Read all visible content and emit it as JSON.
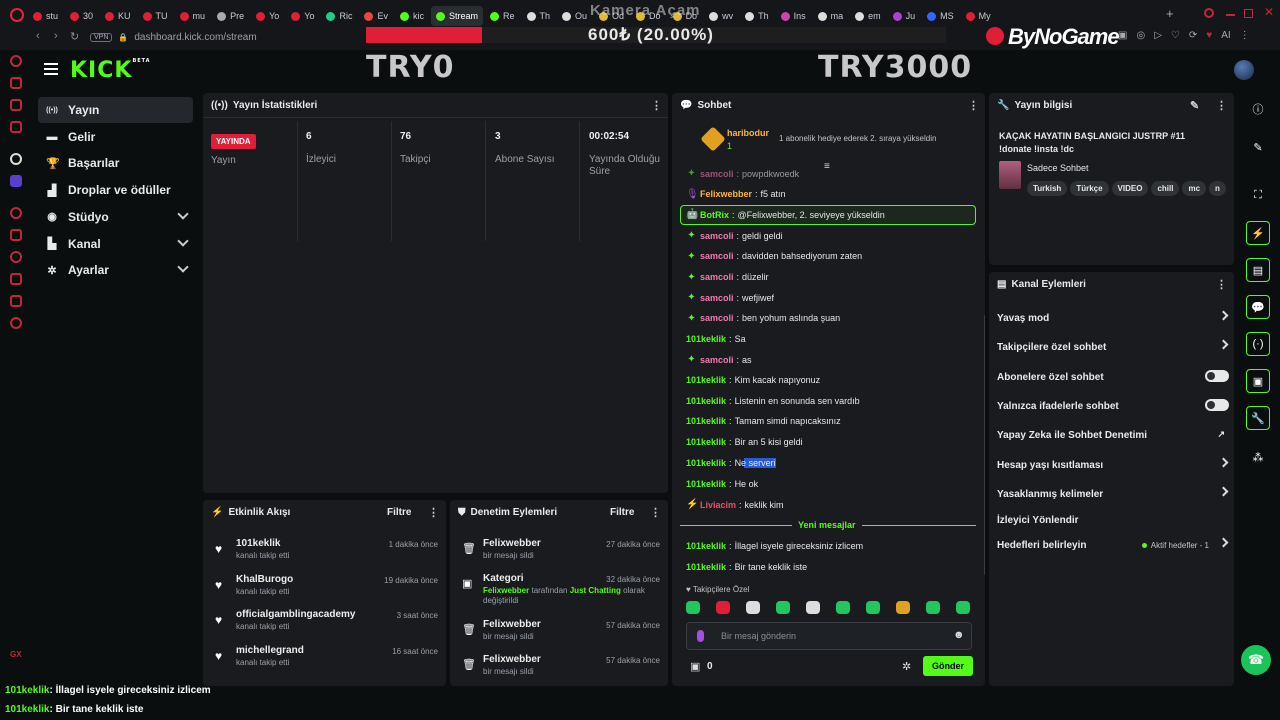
{
  "browser": {
    "tabs": [
      "stu",
      "30",
      "KU",
      "TU",
      "mu",
      "Pre",
      "Yo",
      "Yo",
      "Ric",
      "Ev",
      "kic",
      "Stream",
      "Re",
      "Th",
      "Ou",
      "Od",
      "Do",
      "Do",
      "wv",
      "Th",
      "Ins",
      "ma",
      "em",
      "Ju",
      "MS",
      "My"
    ],
    "active_tab_index": 11,
    "vpn": "VPN",
    "url": "dashboard.kick.com/stream"
  },
  "overlay": {
    "donation_title": "Kamera Açam",
    "donation_amount": "600₺ (20.00%)",
    "donation_progress": 0.2,
    "goal_left": "TRY0",
    "goal_right": "TRY3000",
    "sponsor": "ByNoGame",
    "ai_label": "AI"
  },
  "kick": {
    "logo": "KICK",
    "beta": "BETA"
  },
  "nav": [
    {
      "label": "Yayın",
      "icon": "broadcast-icon",
      "glyph": "((•))",
      "active": true,
      "expand": false
    },
    {
      "label": "Gelir",
      "icon": "revenue-icon",
      "glyph": "▬",
      "active": false,
      "expand": false
    },
    {
      "label": "Başarılar",
      "icon": "trophy-icon",
      "glyph": "🏆",
      "active": false,
      "expand": false
    },
    {
      "label": "Droplar ve ödüller",
      "icon": "drops-icon",
      "glyph": "▟",
      "active": false,
      "expand": false
    },
    {
      "label": "Stüdyo",
      "icon": "studio-icon",
      "glyph": "◉",
      "active": false,
      "expand": true
    },
    {
      "label": "Kanal",
      "icon": "channel-icon",
      "glyph": "▙",
      "active": false,
      "expand": true
    },
    {
      "label": "Ayarlar",
      "icon": "settings-icon",
      "glyph": "✲",
      "active": false,
      "expand": true
    }
  ],
  "stats": {
    "title": "Yayın İstatistikleri",
    "live_badge": "YAYINDA",
    "items": [
      {
        "value": "",
        "label": "Yayın"
      },
      {
        "value": "6",
        "label": "İzleyici"
      },
      {
        "value": "76",
        "label": "Takipçi"
      },
      {
        "value": "3",
        "label": "Abone Sayısı"
      },
      {
        "value": "00:02:54",
        "label": "Yayında Olduğu Süre"
      }
    ]
  },
  "activity": {
    "title": "Etkinlik Akışı",
    "filter": "Filtre",
    "items": [
      {
        "name": "101keklik",
        "sub": "kanalı takip etti",
        "time": "1 dakika önce"
      },
      {
        "name": "KhalBurogo",
        "sub": "kanalı takip etti",
        "time": "19 dakika önce"
      },
      {
        "name": "officialgamblingacademy",
        "sub": "kanalı takip etti",
        "time": "3 saat önce"
      },
      {
        "name": "michellegrand",
        "sub": "kanalı takip etti",
        "time": "16 saat önce"
      }
    ]
  },
  "moderation": {
    "title": "Denetim Eylemleri",
    "filter": "Filtre",
    "items": [
      {
        "name": "Felixwebber",
        "sub": "bir mesajı sildi",
        "time": "27 dakika önce"
      },
      {
        "name": "Kategori",
        "sub_user": "Felixwebber",
        "sub_mid": " tarafından ",
        "sub_cat": "Just Chatting",
        "sub_end": " olarak değiştirildi",
        "time": "32 dakika önce"
      },
      {
        "name": "Felixwebber",
        "sub": "bir mesajı sildi",
        "time": "57 dakika önce"
      },
      {
        "name": "Felixwebber",
        "sub": "bir mesajı sildi",
        "time": "57 dakika önce"
      }
    ]
  },
  "chat": {
    "title": "Sohbet",
    "pinned_user": "haribodur",
    "pinned_count": "1",
    "pinned_text": "1 abonelik hediye ederek 2. sıraya yükseldin",
    "messages": [
      {
        "user": "samcoli",
        "text": "powpdkwoedk",
        "color": "#f07ab0",
        "badge": "✦"
      },
      {
        "user": "Felixwebber",
        "text": "f5 atın",
        "color": "#ffb43c",
        "badge": "🎙"
      },
      {
        "user": "BotRix",
        "text": "@Felixwebber, 2. seviyeye yükseldin",
        "color": "#53fc18",
        "badge": "🤖"
      },
      {
        "user": "samcoli",
        "text": "geldi geldi",
        "color": "#f07ab0",
        "badge": "✦"
      },
      {
        "user": "samcoli",
        "text": "davidden bahsediyorum zaten",
        "color": "#f07ab0",
        "badge": "✦"
      },
      {
        "user": "samcoli",
        "text": "düzelir",
        "color": "#f07ab0",
        "badge": "✦"
      },
      {
        "user": "samcoli",
        "text": "wefjiwef",
        "color": "#f07ab0",
        "badge": "✦"
      },
      {
        "user": "samcoli",
        "text": "ben yohum aslında şuan",
        "color": "#f07ab0",
        "badge": "✦"
      },
      {
        "user": "101keklik",
        "text": "Sa",
        "color": "#53fc18",
        "badge": ""
      },
      {
        "user": "samcoli",
        "text": "as",
        "color": "#f07ab0",
        "badge": "✦"
      },
      {
        "user": "101keklik",
        "text": "Kim kacak napıyonuz",
        "color": "#53fc18",
        "badge": ""
      },
      {
        "user": "101keklik",
        "text": "Listenin en sonunda sen vardıb",
        "color": "#53fc18",
        "badge": ""
      },
      {
        "user": "101keklik",
        "text": "Tamam simdi napıcaksınız",
        "color": "#53fc18",
        "badge": ""
      },
      {
        "user": "101keklik",
        "text": "Bir an 5 kisi geldi",
        "color": "#53fc18",
        "badge": ""
      },
      {
        "user": "101keklik",
        "text": "Ne serveri",
        "color": "#53fc18",
        "badge": ""
      },
      {
        "user": "101keklik",
        "text": "He ok",
        "color": "#53fc18",
        "badge": ""
      },
      {
        "user": "Liviacim",
        "text": "keklik kim",
        "color": "#f04a6e",
        "badge": "⚡"
      }
    ],
    "new_messages_label": "Yeni mesajlar",
    "new_messages": [
      {
        "user": "101keklik",
        "text": "İllagel isyele gireceksiniz izlicem",
        "color": "#53fc18"
      },
      {
        "user": "101keklik",
        "text": "Bir tane keklik iste",
        "color": "#53fc18"
      }
    ],
    "followers_only": "Takipçilere Özel",
    "input_placeholder": "Bir mesaj gönderin",
    "points": "0",
    "send_label": "Gönder"
  },
  "stream_info": {
    "title": "Yayın bilgisi",
    "stream_title": "KAÇAK HAYATIN BAŞLANGICI JUSTRP #11 !donate !insta !dc",
    "category": "Sadece Sohbet",
    "tags": [
      "Turkish",
      "Türkçe",
      "VIDEO",
      "chill",
      "mc",
      "n"
    ]
  },
  "channel_actions": {
    "title": "Kanal Eylemleri",
    "items": [
      {
        "label": "Yavaş mod",
        "kind": "arrow"
      },
      {
        "label": "Takipçilere özel sohbet",
        "kind": "arrow"
      },
      {
        "label": "Abonelere özel sohbet",
        "kind": "toggle"
      },
      {
        "label": "Yalnızca ifadelerle sohbet",
        "kind": "toggle"
      },
      {
        "label": "Yapay Zeka ile Sohbet Denetimi",
        "kind": "external"
      },
      {
        "label": "Hesap yaşı kısıtlaması",
        "kind": "arrow"
      },
      {
        "label": "Yasaklanmış kelimeler",
        "kind": "arrow"
      },
      {
        "label": "İzleyici Yönlendir",
        "kind": "none"
      },
      {
        "label": "Hedefleri belirleyin",
        "kind": "arrow"
      }
    ],
    "active_goals": "Aktif hedefler - 1"
  },
  "bottom_overlay": [
    {
      "user": "101keklik",
      "text": ": İllagel isyele gireceksiniz izlicem"
    },
    {
      "user": "101keklik",
      "text": ": Bir tane keklik iste"
    }
  ],
  "opera_gx": "GX"
}
